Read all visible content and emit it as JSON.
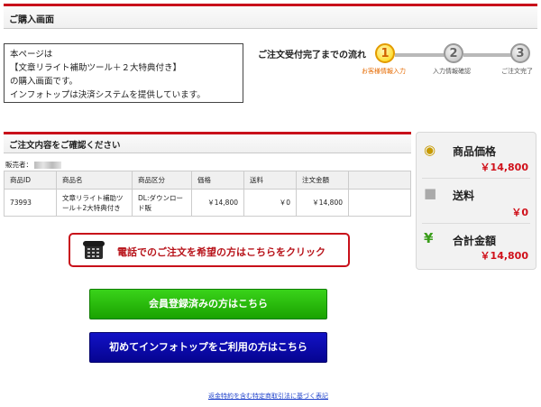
{
  "header": {
    "title": "ご購入画面"
  },
  "intro": {
    "lines": [
      "本ページは",
      "【文章リライト補助ツール＋２大特典付き】",
      "の購入画面です。",
      "インフォトップは決済システムを提供しています。"
    ]
  },
  "flow": {
    "title": "ご注文受付完了までの流れ",
    "steps": [
      {
        "number": "1",
        "label": "お客様情報入力"
      },
      {
        "number": "2",
        "label": "入力情報確認"
      },
      {
        "number": "3",
        "label": "ご注文完了"
      }
    ]
  },
  "confirm": {
    "title": "ご注文内容をご確認ください",
    "seller_label": "販売者："
  },
  "order_table": {
    "headers": [
      "商品ID",
      "商品名",
      "商品区分",
      "価格",
      "送料",
      "注文金額",
      ""
    ],
    "row": [
      "73993",
      "文章リライト補助ツール＋2大特典付き",
      "DL:ダウンロード販",
      "￥14,800",
      "￥0",
      "￥14,800",
      ""
    ]
  },
  "price_panel": {
    "price_label": "商品価格",
    "price_value": "￥14,800",
    "shipping_label": "送料",
    "shipping_value": "￥0",
    "total_label": "合計金額",
    "total_value": "￥14,800",
    "icons": {
      "price": "coin-stack-icon",
      "shipping": "box-icon",
      "total": "yen-icon"
    }
  },
  "buttons": {
    "phone": "電話でのご注文を希望の方はこちらをクリック",
    "member": "会員登録済みの方はこちら",
    "first_time": "初めてインフォトップをご利用の方はこちら"
  },
  "footer": {
    "link": "返金特約を含む特定商取引法に基づく表記"
  },
  "colors": {
    "accent_red": "#c8101a",
    "green": "#1aa200",
    "blue": "#060490",
    "step_active": "#ffd400"
  }
}
